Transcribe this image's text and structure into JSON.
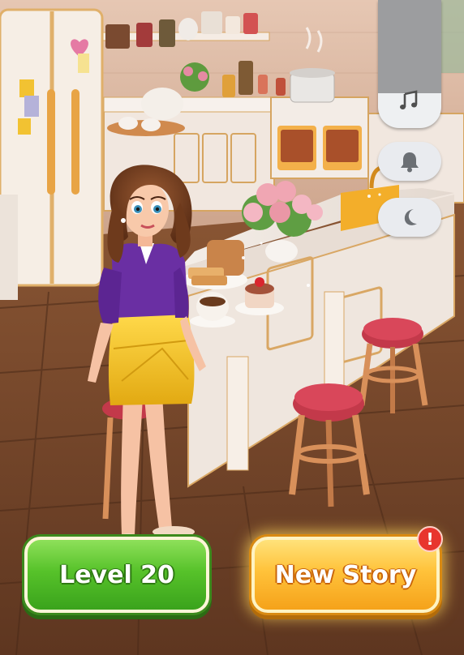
{
  "buttons": {
    "level_label": "Level 20",
    "new_story_label": "New Story",
    "alert_badge": "!"
  },
  "side_controls": {
    "volume_level": 0.73,
    "volume_icon": "music-note-icon",
    "notification_icon": "bell-icon",
    "night_mode_icon": "moon-icon"
  },
  "colors": {
    "level_button": "#4cb821",
    "new_story_button": "#fbb02a",
    "alert_badge": "#e8352e",
    "floor": "#7a4a2c",
    "wall": "#d9b6a0"
  }
}
